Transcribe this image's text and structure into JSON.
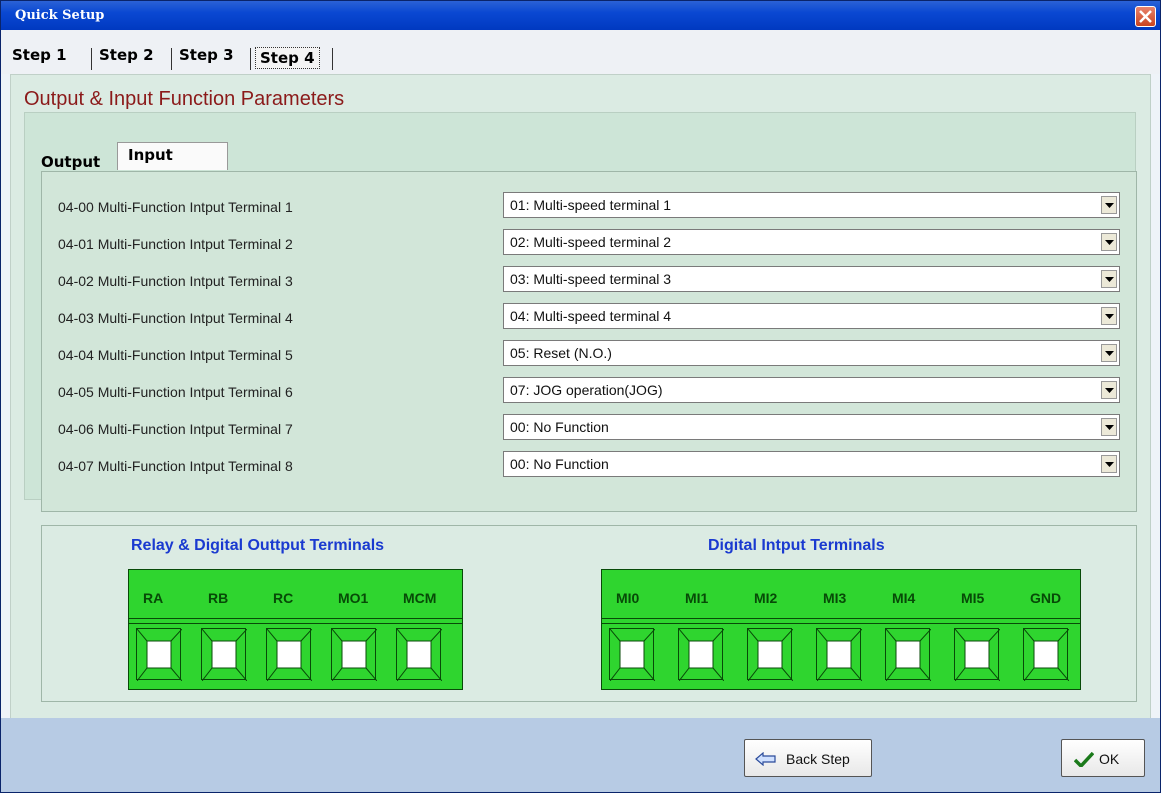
{
  "window": {
    "title": "Quick Setup"
  },
  "steps": [
    {
      "label": "Step 1",
      "active": false
    },
    {
      "label": "Step 2",
      "active": false
    },
    {
      "label": "Step 3",
      "active": false
    },
    {
      "label": "Step 4",
      "active": true
    }
  ],
  "section_title": "Output & Input Function Parameters",
  "tabs": {
    "output": "Output",
    "input": "Input"
  },
  "params": [
    {
      "label": "04-00  Multi-Function Intput Terminal 1",
      "value": "01: Multi-speed terminal 1"
    },
    {
      "label": "04-01  Multi-Function Intput Terminal 2",
      "value": "02: Multi-speed terminal 2"
    },
    {
      "label": "04-02  Multi-Function Intput Terminal 3",
      "value": "03: Multi-speed terminal 3"
    },
    {
      "label": "04-03  Multi-Function Intput Terminal 4",
      "value": "04: Multi-speed terminal 4"
    },
    {
      "label": "04-04  Multi-Function Intput Terminal 5",
      "value": "05: Reset (N.O.)"
    },
    {
      "label": "04-05  Multi-Function Intput Terminal 6",
      "value": "07: JOG operation(JOG)"
    },
    {
      "label": "04-06  Multi-Function Intput Terminal 7",
      "value": "00: No Function"
    },
    {
      "label": "04-07  Multi-Function Intput Terminal 8",
      "value": "00: No Function"
    }
  ],
  "terminals": {
    "relay_title": "Relay & Digital Outtput Terminals",
    "relay": [
      "RA",
      "RB",
      "RC",
      "MO1",
      "MCM"
    ],
    "digital_title": "Digital Intput Terminals",
    "digital": [
      "MI0",
      "MI1",
      "MI2",
      "MI3",
      "MI4",
      "MI5",
      "GND"
    ]
  },
  "buttons": {
    "back": "Back Step",
    "ok": "OK"
  },
  "colors": {
    "terminal_green": "#2fd52f",
    "title_red": "#8b1a1a",
    "terminal_title_blue": "#1a3ad0"
  }
}
